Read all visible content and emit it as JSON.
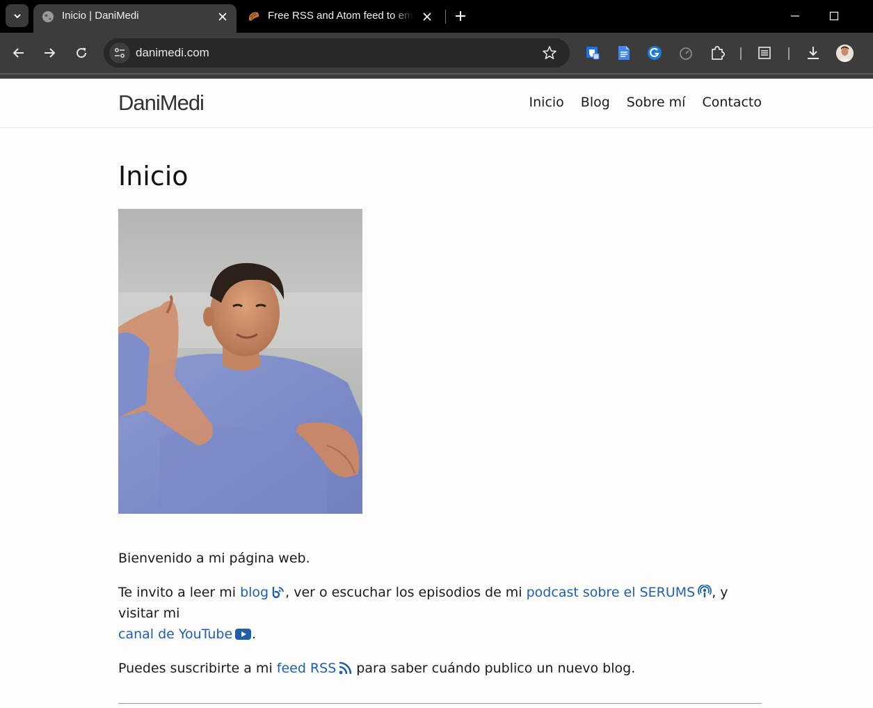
{
  "browser": {
    "tabs": [
      {
        "title": "Inicio | DaniMedi",
        "active": true,
        "favicon": "globe-icon"
      },
      {
        "title": "Free RSS and Atom feed to email",
        "active": false,
        "favicon": "bread-icon"
      }
    ],
    "url": "danimedi.com",
    "extensions": [
      "shield-extension-icon",
      "docs-extension-icon",
      "grammarly-icon",
      "timer-extension-icon",
      "puzzle-icon",
      "reading-list-icon",
      "download-icon"
    ],
    "accent": "#1f5faa"
  },
  "site": {
    "brand": "DaniMedi",
    "nav": [
      {
        "label": "Inicio"
      },
      {
        "label": "Blog"
      },
      {
        "label": "Sobre mí"
      },
      {
        "label": "Contacto"
      }
    ]
  },
  "main": {
    "title": "Inicio",
    "welcome": "Bienvenido a mi página web.",
    "invite": {
      "p1": "Te invito a leer mi ",
      "link_blog": "blog",
      "p2": ", ver o escuchar los episodios de mi ",
      "link_podcast": "podcast sobre el SERUMS",
      "p3": ", y visitar mi ",
      "link_youtube": "canal de YouTube",
      "p4": "."
    },
    "feed": {
      "p1": "Puedes suscribirte a mi ",
      "link_feed": "feed RSS",
      "p2": " para saber cuándo publico un nuevo blog."
    }
  }
}
